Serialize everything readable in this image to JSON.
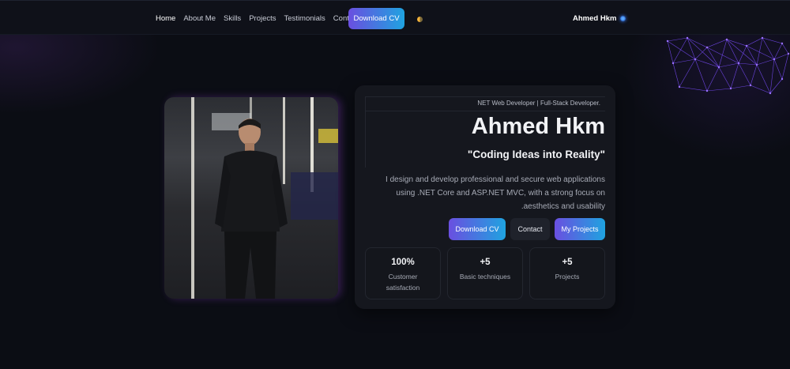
{
  "nav": {
    "links": [
      "Home",
      "About Me",
      "Skills",
      "Projects",
      "Testimonials",
      "Contact"
    ],
    "active": "Home",
    "download_cv": "Download CV",
    "brand": "Ahmed Hkm"
  },
  "hero": {
    "subtitle": "NET Web Developer | Full-Stack Developer.",
    "name": "Ahmed Hkm",
    "tagline": "\"Coding Ideas into Reality\"",
    "description": "I design and develop professional and secure web applications using .NET Core and ASP.NET MVC, with a strong focus on aesthetics and usability.",
    "buttons": {
      "download_cv": "Download CV",
      "contact": "Contact",
      "projects": "My Projects"
    },
    "stats": [
      {
        "value": "100%",
        "label": "Customer satisfaction"
      },
      {
        "value": "+5",
        "label": "Basic techniques"
      },
      {
        "value": "+5",
        "label": "Projects"
      }
    ]
  },
  "colors": {
    "accent_start": "#6a4fe0",
    "accent_end": "#1fa3e0",
    "background": "#0b0d14",
    "card": "#15171e"
  },
  "icons": {
    "theme_toggle": "half-moon-icon",
    "brand_dot": "globe-dot-icon"
  }
}
